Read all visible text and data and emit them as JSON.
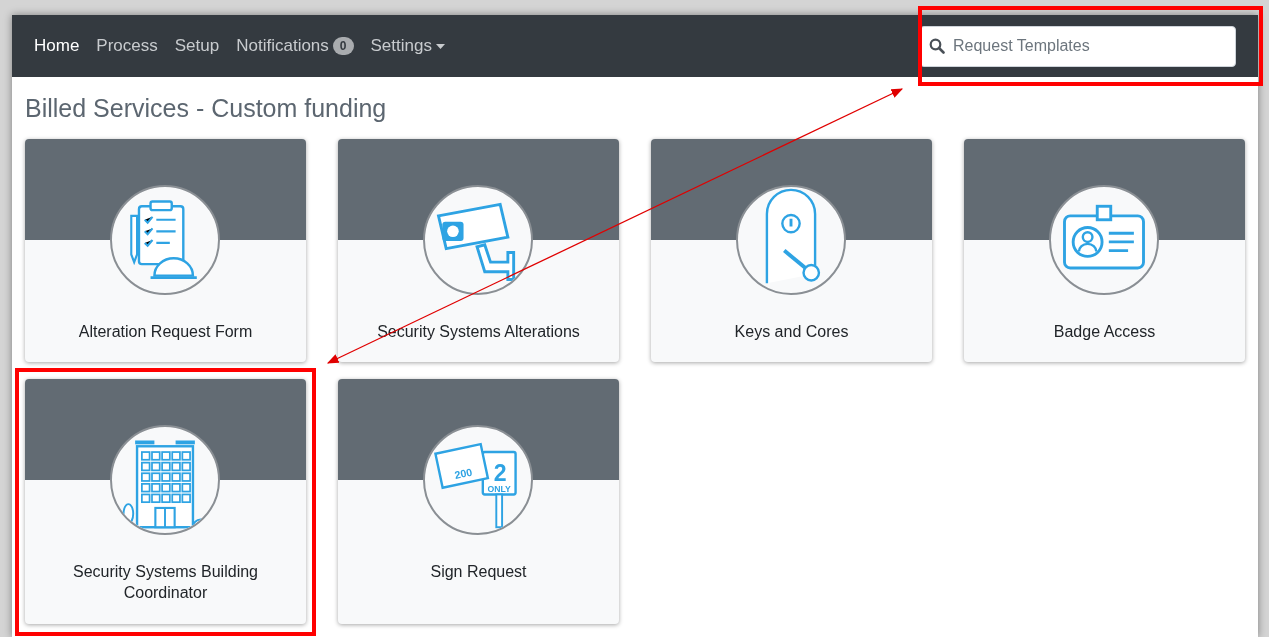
{
  "nav": {
    "items": [
      {
        "label": "Home",
        "selected": true,
        "dropdown": false
      },
      {
        "label": "Process",
        "selected": false,
        "dropdown": false
      },
      {
        "label": "Setup",
        "selected": false,
        "dropdown": false
      },
      {
        "label": "Notifications",
        "selected": false,
        "dropdown": false,
        "badge": "0"
      },
      {
        "label": "Settings",
        "selected": false,
        "dropdown": true
      }
    ],
    "search": {
      "placeholder": "Request Templates"
    }
  },
  "heading": "Billed Services - Custom funding",
  "cards": [
    {
      "title": "Alteration Request Form"
    },
    {
      "title": "Security Systems Alterations"
    },
    {
      "title": "Keys and Cores"
    },
    {
      "title": "Badge Access"
    },
    {
      "title": "Security Systems Building Coordinator"
    },
    {
      "title": "Sign Request",
      "sign_texts": {
        "room": "200",
        "number": "2",
        "note": "ONLY"
      }
    }
  ]
}
